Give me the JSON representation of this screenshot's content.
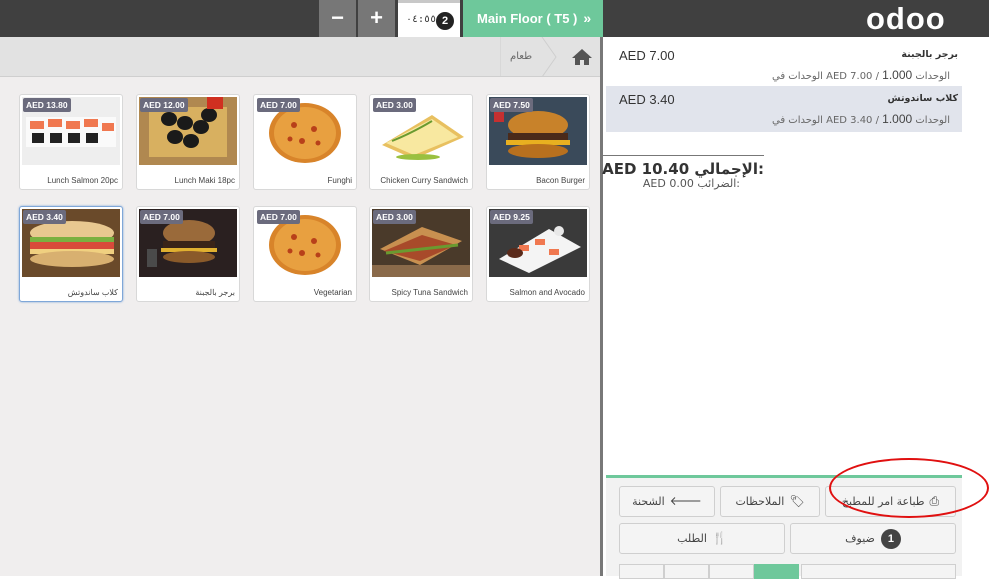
{
  "topbar": {
    "minus_label": "−",
    "plus_label": "+",
    "order_time": "٠٤:٥٥",
    "order_count": "2",
    "floor_button": "Main Floor ( T5 )",
    "logo": "odoo"
  },
  "breadcrumb": {
    "category": "طعام",
    "home_icon": "home-icon"
  },
  "products": [
    {
      "price": "AED 7.50",
      "name": "Bacon Burger",
      "image": "burger"
    },
    {
      "price": "AED 3.00",
      "name": "Chicken Curry Sandwich",
      "image": "sandwich"
    },
    {
      "price": "AED 7.00",
      "name": "Funghi",
      "image": "pizza"
    },
    {
      "price": "AED 12.00",
      "name": "Lunch Maki 18pc",
      "image": "maki"
    },
    {
      "price": "AED 13.80",
      "name": "Lunch Salmon 20pc",
      "image": "sushi"
    },
    {
      "price": "AED 9.25",
      "name": "Salmon and Avocado",
      "image": "sushi-plate"
    },
    {
      "price": "AED 3.00",
      "name": "Spicy Tuna Sandwich",
      "image": "panini"
    },
    {
      "price": "AED 7.00",
      "name": "Vegetarian",
      "image": "pizza"
    },
    {
      "price": "AED 7.00",
      "name": "برجر بالجبنة",
      "image": "burger-dark"
    },
    {
      "price": "AED 3.40",
      "name": "كلاب ساندوتش",
      "image": "club-sandwich"
    }
  ],
  "order": {
    "lines": [
      {
        "name": "برجر بالجبنة",
        "price": "AED 7.00",
        "qty": "1.000",
        "unit_info": "الوحدات في AED 7.00 / الوحدات"
      },
      {
        "name": "كلاب ساندوتش",
        "price": "AED 3.40",
        "qty": "1.000",
        "unit_info": "الوحدات في AED 3.40 / الوحدات"
      }
    ],
    "total_label": "الإجمالي:",
    "total_value": "AED 10.40",
    "taxes_label": "الضرائب:",
    "taxes_value": "AED 0.00"
  },
  "controls": {
    "print_kitchen": "طباعة امر للمطبخ",
    "notes": "الملاحظات",
    "transfer": "الشحنة",
    "guests": "ضيوف",
    "guests_count": "1",
    "order_btn": "الطلب"
  },
  "colors": {
    "topbar": "#404040",
    "accent_green": "#6ec89b",
    "selected_line": "#e1e4ec",
    "annotation_red": "#e01010"
  }
}
